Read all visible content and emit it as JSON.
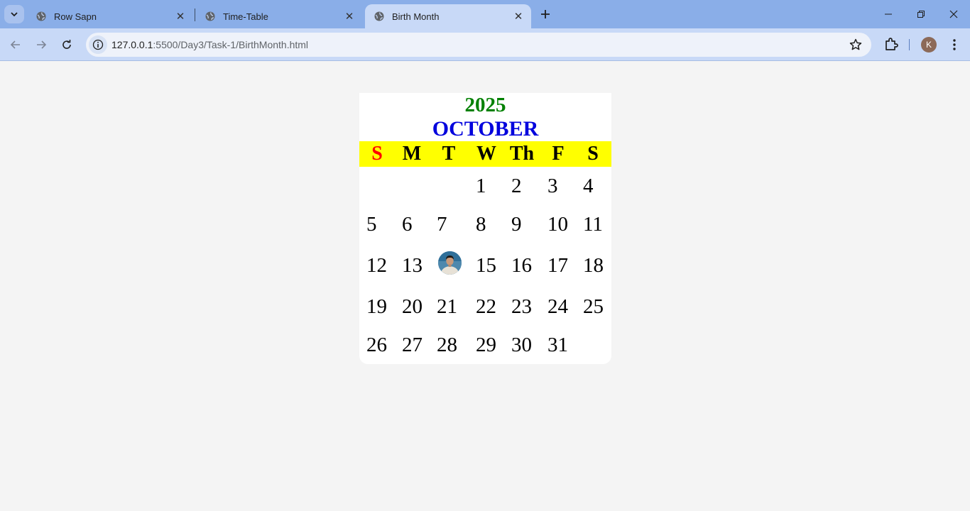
{
  "browser": {
    "tabs": [
      {
        "title": "Row Sapn",
        "active": false,
        "icon": "globe-icon"
      },
      {
        "title": "Time-Table",
        "active": false,
        "icon": "globe-icon"
      },
      {
        "title": "Birth Month",
        "active": true,
        "icon": "globe-icon"
      }
    ],
    "url_host": "127.0.0.1",
    "url_path": ":5500/Day3/Task-1/BirthMonth.html",
    "profile_initial": "K"
  },
  "calendar": {
    "year": "2025",
    "month": "OCTOBER",
    "weekdays": [
      "S",
      "M",
      "T",
      "W",
      "Th",
      "F",
      "S"
    ],
    "highlight_day_image": "profile-photo",
    "days": [
      [
        "",
        "",
        "",
        "1",
        "2",
        "3",
        "4"
      ],
      [
        "5",
        "6",
        "7",
        "8",
        "9",
        "10",
        "11"
      ],
      [
        "12",
        "13",
        "",
        "15",
        "16",
        "17",
        "18"
      ],
      [
        "19",
        "20",
        "21",
        "22",
        "23",
        "24",
        "25"
      ],
      [
        "26",
        "27",
        "28",
        "29",
        "30",
        "31",
        ""
      ]
    ]
  },
  "colors": {
    "year": "#008000",
    "month": "#0000dd",
    "header_bg": "#ffff00",
    "sunday": "#ff0000"
  }
}
